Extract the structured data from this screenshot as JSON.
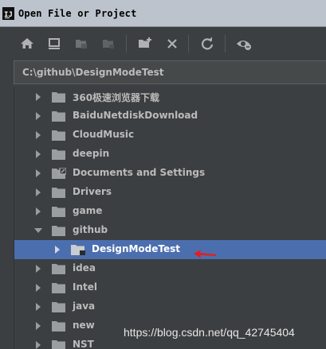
{
  "window": {
    "title": "Open File or Project",
    "icon": "intellij-idea-logo"
  },
  "toolbar": {
    "buttons": [
      {
        "name": "home",
        "icon": "home-icon"
      },
      {
        "name": "desktop",
        "icon": "monitor-icon"
      },
      {
        "name": "project",
        "icon": "project-folder-icon"
      },
      {
        "name": "module",
        "icon": "module-icon"
      },
      {
        "name": "new-folder",
        "icon": "new-folder-icon"
      },
      {
        "name": "delete",
        "icon": "close-icon"
      },
      {
        "name": "refresh",
        "icon": "refresh-icon"
      },
      {
        "name": "show-hidden",
        "icon": "eye-icon"
      }
    ]
  },
  "path": {
    "value": "C:\\github\\DesignModeTest"
  },
  "tree": {
    "items": [
      {
        "label": "360极速浏览器下载",
        "level": 0,
        "expanded": false,
        "special": false
      },
      {
        "label": "BaiduNetdiskDownload",
        "level": 0,
        "expanded": false,
        "special": false
      },
      {
        "label": "CloudMusic",
        "level": 0,
        "expanded": false,
        "special": false
      },
      {
        "label": "deepin",
        "level": 0,
        "expanded": false,
        "special": false
      },
      {
        "label": "Documents and Settings",
        "level": 0,
        "expanded": false,
        "special": true
      },
      {
        "label": "Drivers",
        "level": 0,
        "expanded": false,
        "special": false
      },
      {
        "label": "game",
        "level": 0,
        "expanded": false,
        "special": false
      },
      {
        "label": "github",
        "level": 0,
        "expanded": true,
        "special": false
      },
      {
        "label": "DesignModeTest",
        "level": 1,
        "expanded": false,
        "selected": true,
        "special": false
      },
      {
        "label": "idea",
        "level": 0,
        "expanded": false,
        "special": false
      },
      {
        "label": "Intel",
        "level": 0,
        "expanded": false,
        "special": false
      },
      {
        "label": "java",
        "level": 0,
        "expanded": false,
        "special": false
      },
      {
        "label": "new",
        "level": 0,
        "expanded": false,
        "special": false
      },
      {
        "label": "NST",
        "level": 0,
        "expanded": false,
        "special": false
      }
    ]
  },
  "colors": {
    "selection": "#4b6eaf",
    "annotation_arrow": "#e02020"
  },
  "watermark": {
    "text": "https://blog.csdn.net/qq_42745404"
  }
}
